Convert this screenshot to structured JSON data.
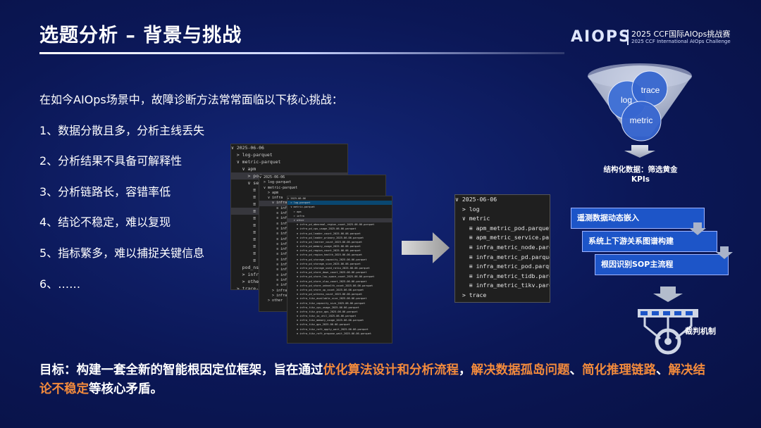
{
  "header": {
    "title": "选题分析 – 背景与挑战",
    "logo_text": "AIOPS",
    "logo_cn": "2025 CCF国际AIOps挑战赛",
    "logo_en": "2025 CCF International AIOps Challenge"
  },
  "body": {
    "intro": "在如今AIOps场景中，故障诊断方法常常面临以下核心挑战：",
    "challenges": [
      "1、数据分散且多，分析主线丢失",
      "2、分析结果不具备可解释性",
      "3、分析链路长，容错率低",
      "4、结论不稳定，难以复现",
      "5、指标繁多，难以捕捉关键信息",
      "6、……"
    ]
  },
  "goal": {
    "prefix": "目标：构建一套全新的智能根因定位框架，旨在通过",
    "hl1": "优化算法设计和分析流程",
    "sep1": "，",
    "hl2": "解决数据孤岛问题",
    "sep2": "、",
    "hl3": "简化推理链路",
    "sep3": "、",
    "hl4": "解决结论不稳定",
    "suffix": "等核心矛盾。"
  },
  "panel1": {
    "rows": [
      "∨ 2025-06-06",
      "  > log-parquet",
      "  ∨ metric-parquet",
      "    ∨ apm",
      "      > pod",
      "      ∨ service",
      "        ≡ service",
      "        ≡ service",
      "        ≡ service",
      "        ≡ service",
      "        ≡ service",
      "        ≡ service",
      "        ≡ service",
      "        ≡ service",
      "        ≡ service",
      "        ≡ service",
      "        ≡ service",
      "    pod_ns_",
      "    > infra",
      "    > other",
      "  > trace-parqu"
    ]
  },
  "panel2": {
    "rows": [
      "∨ 2025-06-06",
      "  > log-parquet",
      "  ∨ metric-parquet",
      "    > apm",
      "    ∨ infra",
      "      ∨ infra_node",
      "        ≡ infra_noc",
      "        ≡ infra_noc",
      "        ≡ infra_noc",
      "        ≡ infra_noc",
      "        ≡ infra_noc",
      "        ≡ infra_noc",
      "        ≡ infra_noc",
      "        ≡ infra_noc",
      "        ≡ infra_noc",
      "        ≡ infra_noc",
      "        ≡ infra_noc",
      "        ≡ infra_noc",
      "        ≡ infra_noc",
      "        ≡ infra_noc",
      "        ≡ infra_noc",
      "        ≡ infra_noc",
      "      > infra_pod",
      "      > infra_tidb",
      "    > other"
    ]
  },
  "panel3": {
    "rows": [
      "∨ 2025-06-06",
      "  > log-parquet",
      "  ∨ metric-parquet",
      "    > apm",
      "    > infra",
      "    ∨ other",
      "      ≡ infra_pd_abnormal_region_count_2025-06-06.parquet",
      "      ≡ infra_pd_cpu_usage_2025-06-06.parquet",
      "      ≡ infra_pd_leader_count_2025-06-06.parquet",
      "      ≡ infra_pd_leader_primary_2025-06-06.parquet",
      "      ≡ infra_pd_learner_count_2025-06-06.parquet",
      "      ≡ infra_pd_memory_usage_2025-06-06.parquet",
      "      ≡ infra_pd_region_count_2025-06-06.parquet",
      "      ≡ infra_pd_region_health_2025-06-06.parquet",
      "      ≡ infra_pd_storage_capacity_2025-06-06.parquet",
      "      ≡ infra_pd_storage_size_2025-06-06.parquet",
      "      ≡ infra_pd_storage_used_ratio_2025-06-06.parquet",
      "      ≡ infra_pd_store_down_count_2025-06-06.parquet",
      "      ≡ infra_pd_store_low_space_count_2025-06-06.parquet",
      "      ≡ infra_pd_store_slow_count_2025-06-06.parquet",
      "      ≡ infra_pd_store_unhealth_count_2025-06-06.parquet",
      "      ≡ infra_pd_store_up_count_2025-06-06.parquet",
      "      ≡ infra_pd_witness_count_2025-06-06.parquet",
      "      ≡ infra_tikv_available_size_2025-06-06.parquet",
      "      ≡ infra_tikv_capacity_size_2025-06-06.parquet",
      "      ≡ infra_tikv_cpu_usage_2025-06-06.parquet",
      "      ≡ infra_tikv_grpc_qps_2025-06-06.parquet",
      "      ≡ infra_tikv_io_util_2025-06-06.parquet",
      "      ≡ infra_tikv_memory_usage_2025-06-06.parquet",
      "      ≡ infra_tikv_qps_2025-06-06.parquet",
      "      ≡ infra_tikv_raft_apply_wait_2025-06-06.parquet",
      "      ≡ infra_tikv_raft_propose_wait_2025-06-06.parquet"
    ]
  },
  "panel4": {
    "rows": [
      "∨ 2025-06-06",
      "  > log",
      "  ∨ metric",
      "    ≡ apm_metric_pod.parquet",
      "    ≡ apm_metric_service.parquet",
      "    ≡ infra_metric_node.parquet",
      "    ≡ infra_metric_pd.parquet",
      "    ≡ infra_metric_pod.parquet",
      "    ≡ infra_metric_tidb.parquet",
      "    ≡ infra_metric_tikv.parquet",
      "  > trace"
    ]
  },
  "diagram": {
    "circle_trace": "trace",
    "circle_log": "log",
    "circle_metric": "metric",
    "struct_label_1": "结构化数据：筛选黄金",
    "struct_label_2": "KPIs",
    "step1": "遥测数据动态嵌入",
    "step2": "系统上下游关系图谱构建",
    "step3": "根因识别SOP主流程",
    "judge_label": "裁判机制"
  },
  "colors": {
    "accent": "#f28a3c",
    "step_fill": "#1d55c8",
    "background": "#0b1756"
  }
}
